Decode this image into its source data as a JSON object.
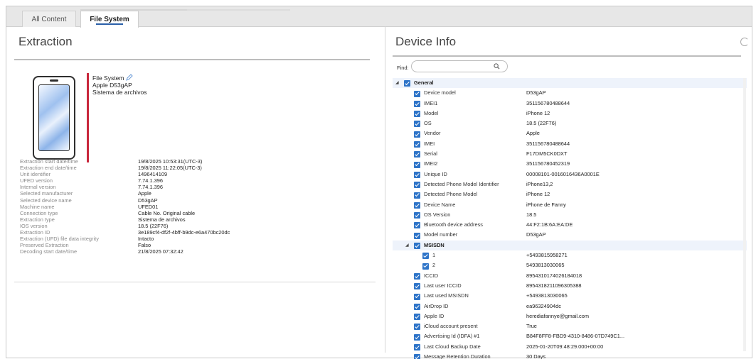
{
  "tabs": [
    {
      "label": "All Content",
      "active": false
    },
    {
      "label": "File System",
      "active": true
    }
  ],
  "extraction": {
    "title": "Extraction",
    "device_lines": [
      "File System",
      "Apple D53gAP",
      "Sistema de archivos"
    ],
    "properties": [
      {
        "key": "Extraction start date/time",
        "value": "19/8/2025 10:53:31(UTC-3)"
      },
      {
        "key": "Extraction end date/time",
        "value": "19/8/2025 11:22:05(UTC-3)"
      },
      {
        "key": "Unit identifier",
        "value": "1496414109"
      },
      {
        "key": "UFED version",
        "value": "7.74.1.396"
      },
      {
        "key": "Internal version",
        "value": "7.74.1.396"
      },
      {
        "key": "Selected manufacturer",
        "value": "Apple"
      },
      {
        "key": "Selected device name",
        "value": "D53gAP"
      },
      {
        "key": "Machine name",
        "value": "UFED01"
      },
      {
        "key": "Connection type",
        "value": "Cable No. Original cable"
      },
      {
        "key": "Extraction type",
        "value": "Sistema de archivos"
      },
      {
        "key": "IOS version",
        "value": "18.5 (22F76)"
      },
      {
        "key": "Extraction ID",
        "value": "3e189cf4-df2f-4bff-b9dc-e6a470bc20dc"
      },
      {
        "key": "Extraction (UFD) file data integrity",
        "value": "Intacto"
      },
      {
        "key": "Preserved Extraction",
        "value": "Falso"
      },
      {
        "key": "Decoding start date/time",
        "value": "21/8/2025 07:32:42"
      }
    ]
  },
  "device_info": {
    "title": "Device Info",
    "find_label": "Find:",
    "find_value": "",
    "general_label": "General",
    "msisdn_label": "MSISDN",
    "general_items": [
      {
        "label": "Device model",
        "value": "D53gAP"
      },
      {
        "label": "IMEI1",
        "value": "351156780488644"
      },
      {
        "label": "Model",
        "value": "iPhone 12"
      },
      {
        "label": "OS",
        "value": "18.5 (22F76)"
      },
      {
        "label": "Vendor",
        "value": "Apple"
      },
      {
        "label": "IMEI",
        "value": "351156780488644"
      },
      {
        "label": "Serial",
        "value": "F17DM5CK0DXT"
      },
      {
        "label": "IMEI2",
        "value": "351156780452319"
      },
      {
        "label": "Unique ID",
        "value": "00008101-0016016436A0001E"
      },
      {
        "label": "Detected Phone Model Identifier",
        "value": "iPhone13,2"
      },
      {
        "label": "Detected Phone Model",
        "value": "iPhone 12"
      },
      {
        "label": "Device Name",
        "value": "iPhone de Fanny"
      },
      {
        "label": "OS Version",
        "value": "18.5"
      },
      {
        "label": "Bluetooth device address",
        "value": "44:F2:1B:6A:EA:DE"
      },
      {
        "label": "Model number",
        "value": "D53gAP"
      }
    ],
    "msisdn_items": [
      {
        "label": "1",
        "value": "+5493815958271"
      },
      {
        "label": "2",
        "value": "5493813030065"
      }
    ],
    "after_items": [
      {
        "label": "ICCID",
        "value": "8954310174026184018"
      },
      {
        "label": "Last user ICCID",
        "value": "8954318211096305388"
      },
      {
        "label": "Last used MSISDN",
        "value": "+5493813030065"
      },
      {
        "label": "AirDrop ID",
        "value": "ea96324904dc"
      },
      {
        "label": "Apple ID",
        "value": "herediafannye@gmail.com"
      },
      {
        "label": "iCloud account present",
        "value": "True"
      },
      {
        "label": "Advertising Id (IDFA) #1",
        "value": "B84F8FF8-FBD9-4310-8486-07D749C1..."
      },
      {
        "label": "Last Cloud Backup Date",
        "value": "2025-01-20T09:48:29.000+00:00"
      },
      {
        "label": "Message Retention Duration",
        "value": "30 Days"
      }
    ]
  },
  "colors": {
    "accent": "#2e74c8",
    "tab_underline": "#2a5fa8",
    "device_bar": "#c8283c"
  }
}
